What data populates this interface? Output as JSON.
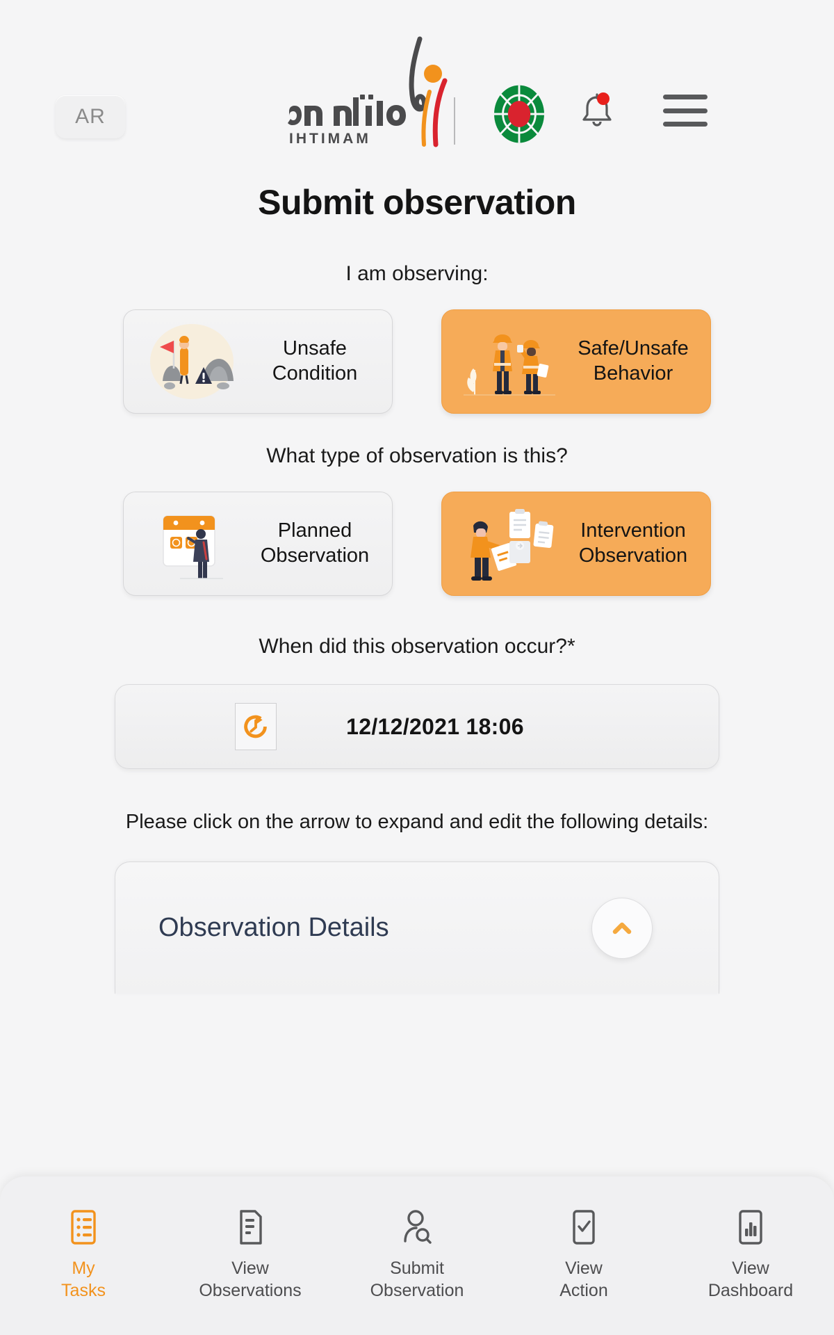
{
  "header": {
    "lang_toggle": "AR",
    "logo_text_arabic": "اهتمام",
    "logo_text_latin": "IHTIMAM",
    "notification_icon": "bell-icon",
    "notification_badge": true,
    "menu_icon": "hamburger-menu-icon"
  },
  "page_title": "Submit observation",
  "questions": {
    "observing": "I am observing:",
    "type": "What type of observation is this?",
    "when": "When did this observation occur?*",
    "expand_hint": "Please click on the arrow to expand and edit the following details:"
  },
  "observing_options": [
    {
      "label_line1": "Unsafe",
      "label_line2": "Condition",
      "illustration": "unsafe-condition-illustration",
      "selected": false
    },
    {
      "label_line1": "Safe/Unsafe",
      "label_line2": "Behavior",
      "illustration": "safe-unsafe-behavior-illustration",
      "selected": true
    }
  ],
  "type_options": [
    {
      "label_line1": "Planned",
      "label_line2": "Observation",
      "illustration": "planned-observation-illustration",
      "selected": false
    },
    {
      "label_line1": "Intervention",
      "label_line2": "Observation",
      "illustration": "intervention-observation-illustration",
      "selected": true
    }
  ],
  "datetime_field": {
    "icon": "clock-refresh-icon",
    "value": "12/12/2021 18:06"
  },
  "accordion": {
    "title": "Observation Details",
    "toggle_icon": "chevron-up-icon",
    "expanded": true
  },
  "bottom_nav": [
    {
      "line1": "My",
      "line2": "Tasks",
      "icon": "tasks-list-icon",
      "active": true
    },
    {
      "line1": "View",
      "line2": "Observations",
      "icon": "document-list-icon",
      "active": false
    },
    {
      "line1": "Submit",
      "line2": "Observation",
      "icon": "person-search-icon",
      "active": false
    },
    {
      "line1": "View",
      "line2": "Action",
      "icon": "checkbox-document-icon",
      "active": false
    },
    {
      "line1": "View",
      "line2": "Dashboard",
      "icon": "bar-chart-icon",
      "active": false
    }
  ],
  "colors": {
    "accent_orange": "#f2921d",
    "selected_card": "#f6ab58",
    "background": "#f5f5f6",
    "heading_navy": "#2f3b52",
    "badge_red": "#e8201c",
    "logo_green": "#0a8a3c"
  }
}
